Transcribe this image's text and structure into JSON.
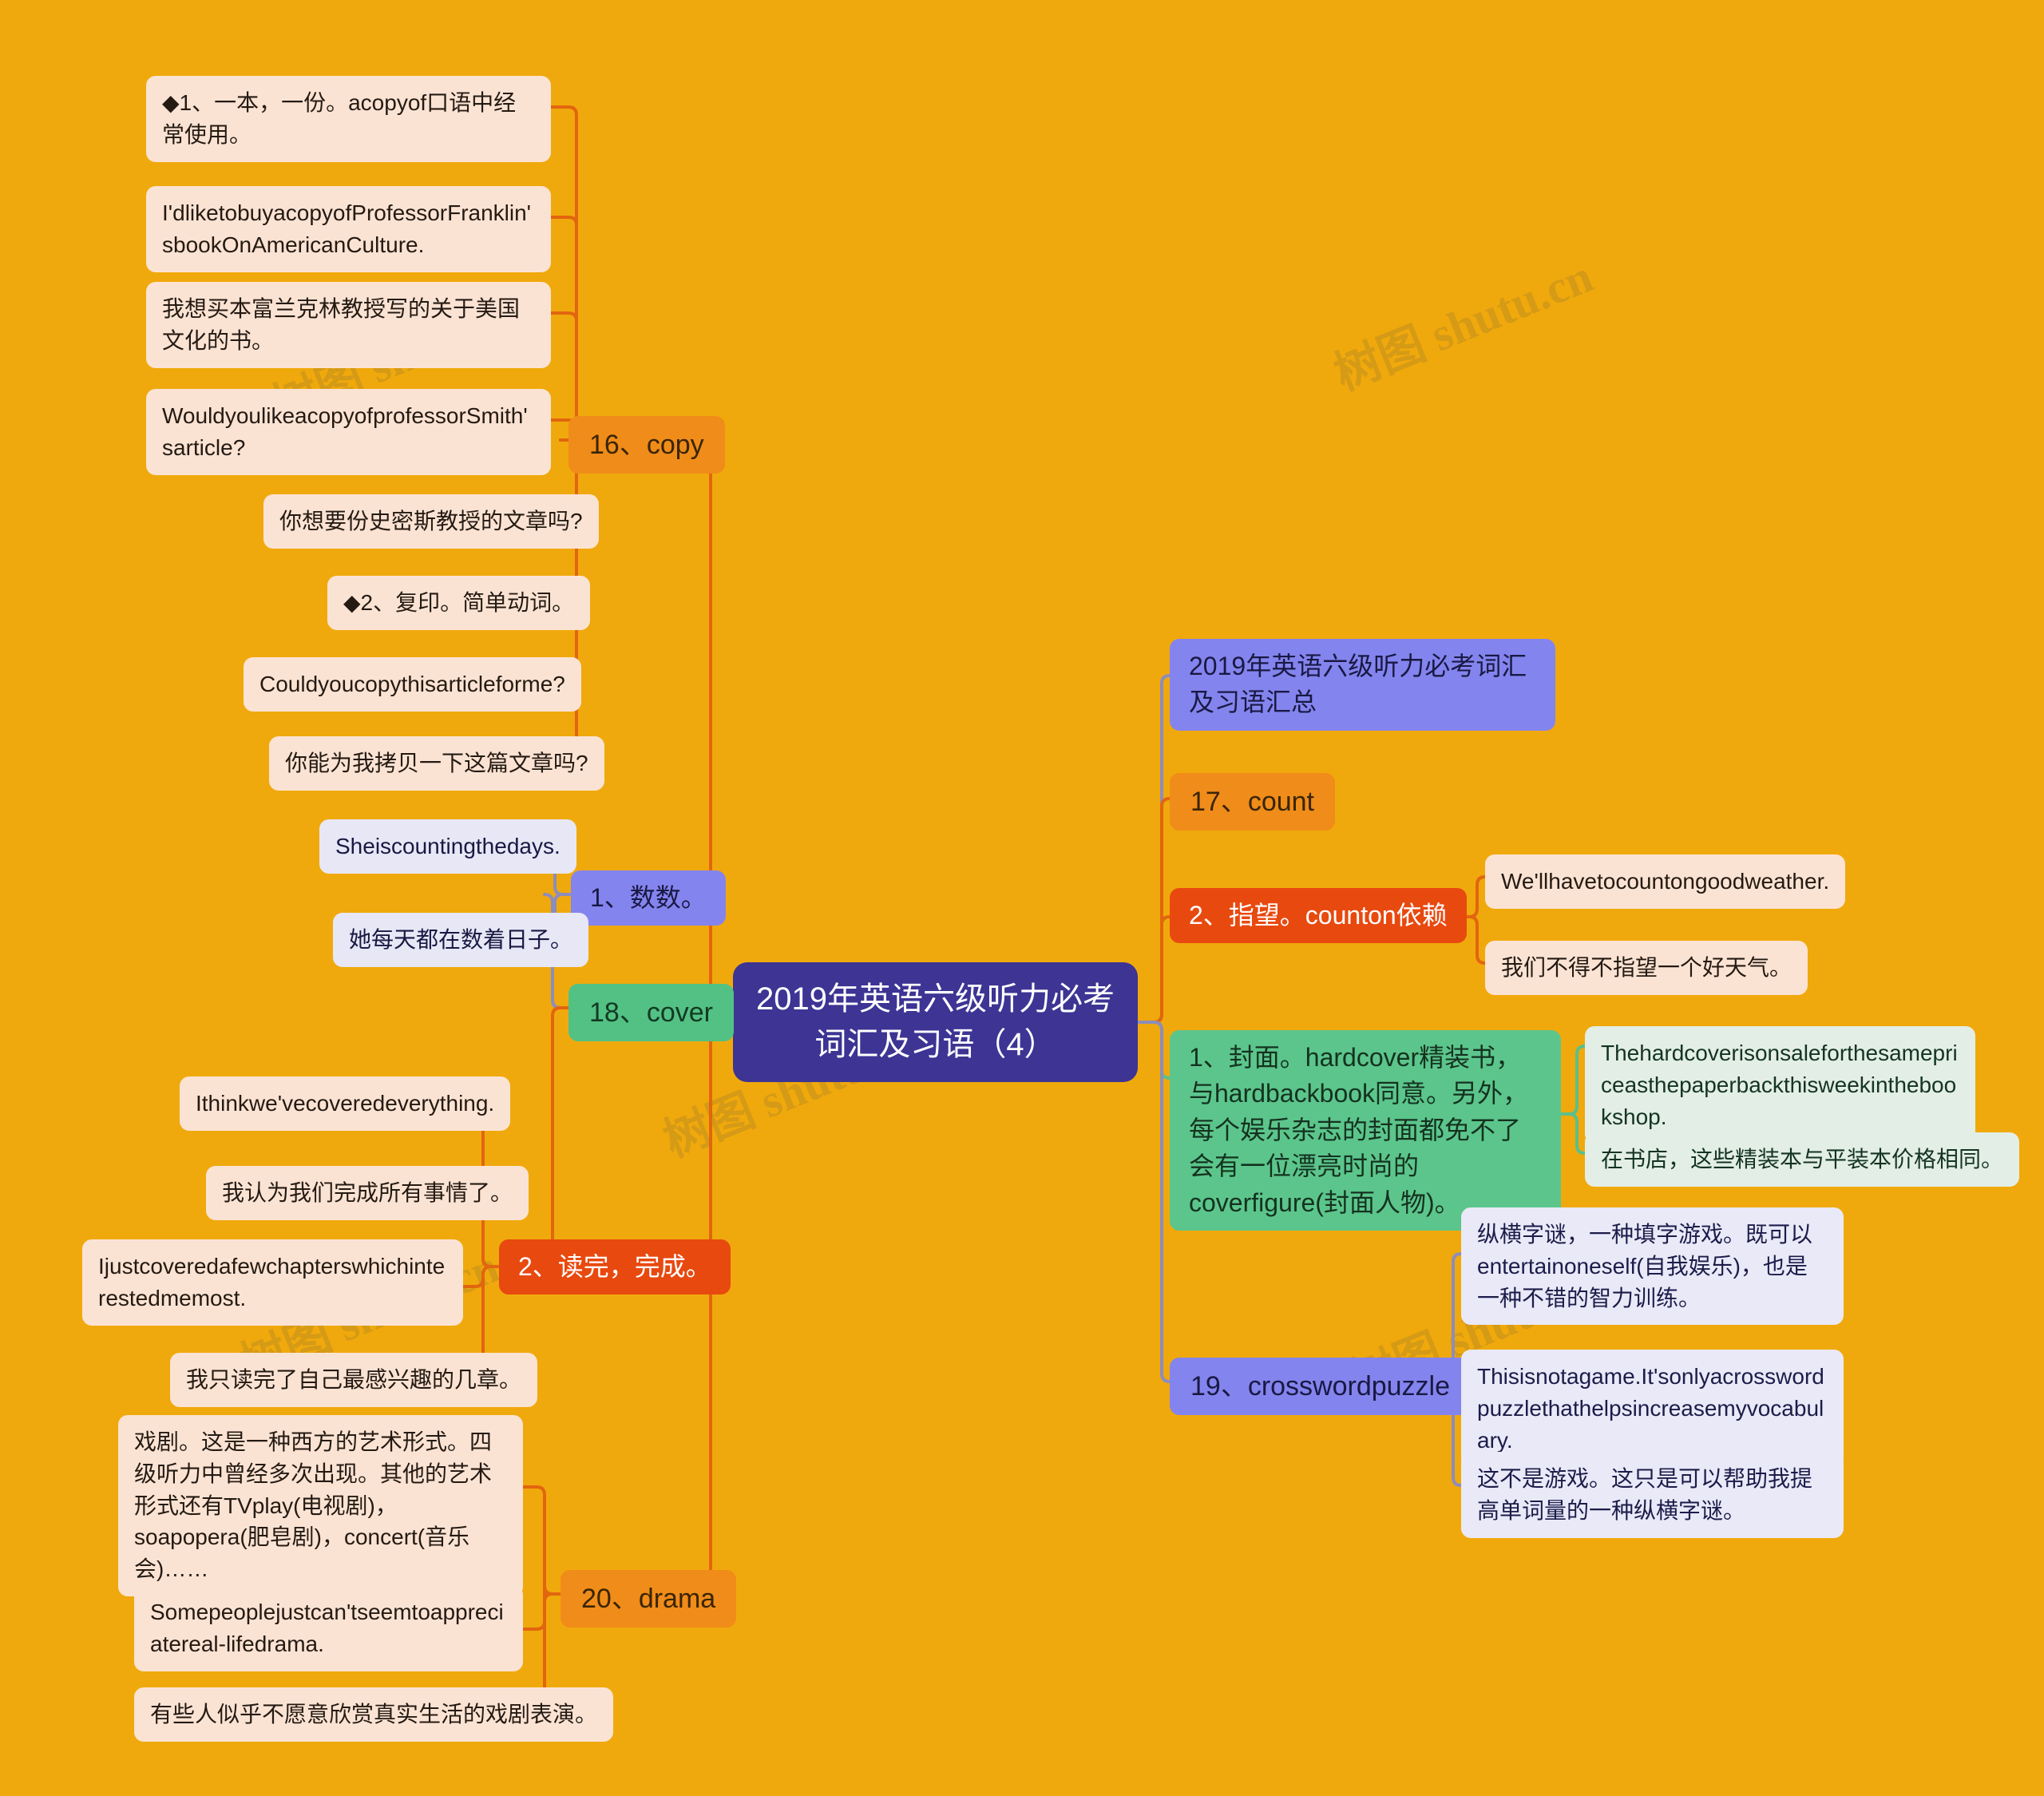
{
  "colors": {
    "background": "#f0a90c",
    "root_bg": "#3d3494",
    "branch_orange": "#f08c1a",
    "branch_green": "#53c183",
    "branch_purple": "#8484ee",
    "sub_red": "#e8490f",
    "leaf_peach": "#fbe3d4",
    "leaf_lavender": "#e7e7f6",
    "leaf_mint": "#e3eee6",
    "edge_orange": "#e2650f",
    "edge_purple": "#8d8dbb",
    "edge_green": "#5cbf8a"
  },
  "watermarks": [
    "树图 shutu.cn",
    "树图 shutu.cn",
    "树图 shutu.cn",
    "树图 shutu.cn",
    "树图 shutu.cn"
  ],
  "root": {
    "label": "2019年英语六级听力必考词汇及习语（4）"
  },
  "branches": {
    "copy": {
      "label": "16、copy",
      "children": [
        {
          "label": "◆1、一本，一份。acopyof口语中经常使用。"
        },
        {
          "label": "I'dliketobuyacopyofProfessorFranklin'sbookOnAmericanCulture."
        },
        {
          "label": "我想买本富兰克林教授写的关于美国文化的书。"
        },
        {
          "label": "WouldyoulikeacopyofprofessorSmith'sarticle?"
        },
        {
          "label": "你想要份史密斯教授的文章吗?"
        },
        {
          "label": "◆2、复印。简单动词。"
        },
        {
          "label": "Couldyoucopythisarticleforme?"
        },
        {
          "label": "你能为我拷贝一下这篇文章吗?"
        }
      ]
    },
    "cover": {
      "label": "18、cover",
      "sub_count": {
        "label": "1、数数。",
        "children": [
          {
            "label": "Sheiscountingthedays."
          },
          {
            "label": "她每天都在数着日子。"
          }
        ]
      },
      "sub_finish": {
        "label": "2、读完，完成。",
        "children": [
          {
            "label": "Ithinkwe'vecoveredeverything."
          },
          {
            "label": "我认为我们完成所有事情了。"
          },
          {
            "label": "Ijustcoveredafewchapterswhichinterestedmemost."
          },
          {
            "label": "我只读完了自己最感兴趣的几章。"
          }
        ]
      }
    },
    "drama": {
      "label": "20、drama",
      "children": [
        {
          "label": "戏剧。这是一种西方的艺术形式。四级听力中曾经多次出现。其他的艺术形式还有TVplay(电视剧)，soapopera(肥皂剧)，concert(音乐会)……"
        },
        {
          "label": "Somepeoplejustcan'tseemtoappreciatereal-lifedrama."
        },
        {
          "label": "有些人似乎不愿意欣赏真实生活的戏剧表演。"
        }
      ]
    },
    "summary": {
      "label": "2019年英语六级听力必考词汇及习语汇总"
    },
    "count": {
      "label": "17、count",
      "sub_rely": {
        "label": "2、指望。counton依赖",
        "children": [
          {
            "label": "We'llhavetocountongoodweather."
          },
          {
            "label": "我们不得不指望一个好天气。"
          }
        ]
      },
      "sub_cover": {
        "label": "1、封面。hardcover精装书，与hardbackbook同意。另外，每个娱乐杂志的封面都免不了会有一位漂亮时尚的coverfigure(封面人物)。",
        "children": [
          {
            "label": "Thehardcoverisonsaleforthesamepriceasthepaperbackthisweekinthebookshop."
          },
          {
            "label": "在书店，这些精装本与平装本价格相同。"
          }
        ]
      }
    },
    "crosswordpuzzle": {
      "label": "19、crosswordpuzzle",
      "children": [
        {
          "label": "纵横字谜，一种填字游戏。既可以entertainoneself(自我娱乐)，也是一种不错的智力训练。"
        },
        {
          "label": "Thisisnotagame.It'sonlyacrosswordpuzzlethathelpsincreasemyvocabulary."
        },
        {
          "label": "这不是游戏。这只是可以帮助我提高单词量的一种纵横字谜。"
        }
      ]
    }
  }
}
